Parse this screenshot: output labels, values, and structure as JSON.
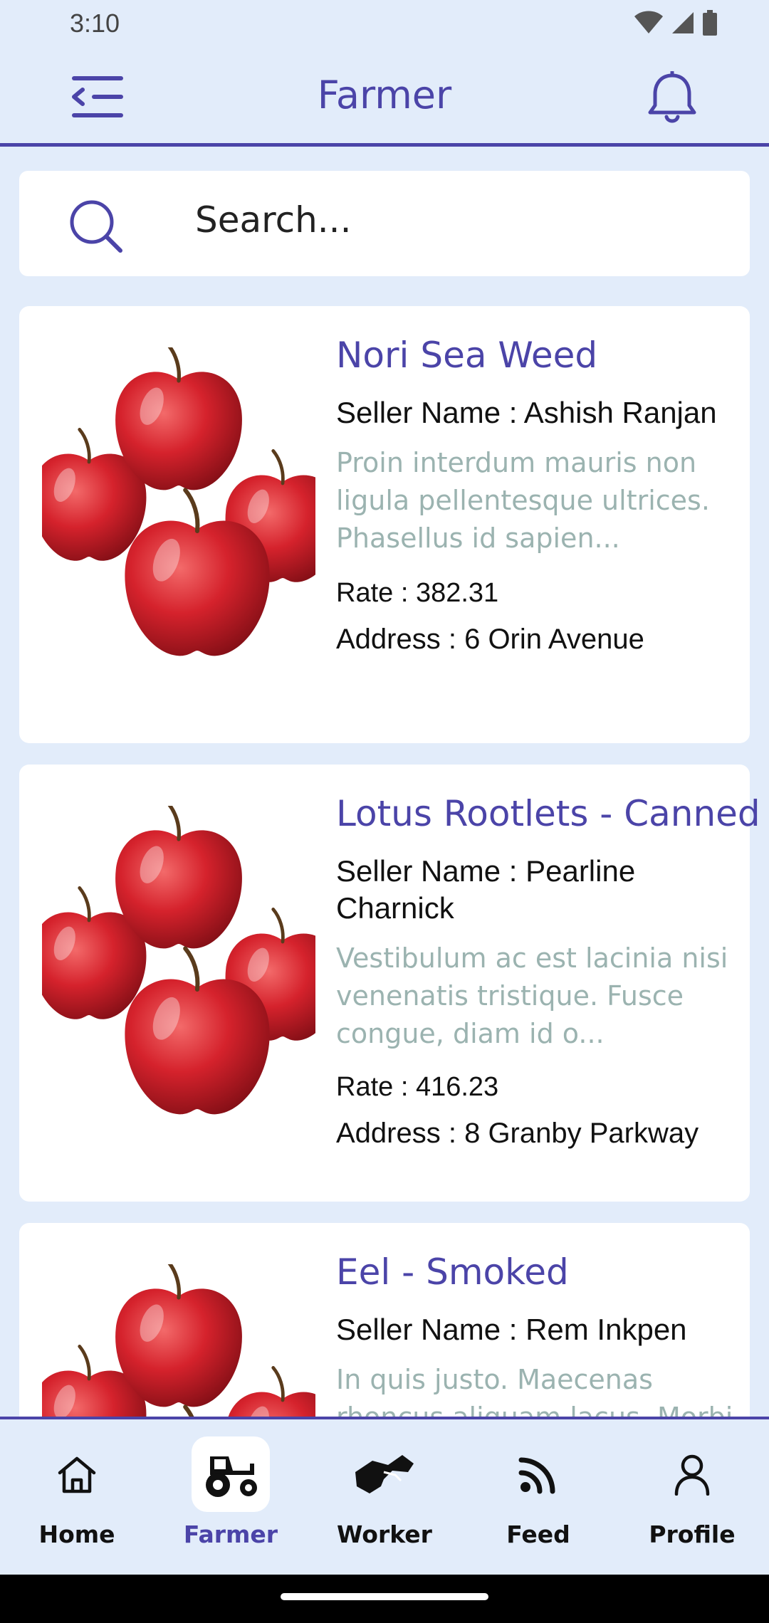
{
  "status_bar": {
    "time": "3:10"
  },
  "app_bar": {
    "title": "Farmer"
  },
  "search": {
    "placeholder": "Search..."
  },
  "products": [
    {
      "title": "Nori Sea Weed",
      "seller": "Seller Name : Ashish Ranjan",
      "description": "Proin interdum mauris non ligula pellentesque ultrices. Phasellus id sapien...",
      "rate": "Rate : 382.31",
      "address": "Address : 6 Orin Avenue",
      "image_icon": "apples-image"
    },
    {
      "title": "Lotus Rootlets - Canned",
      "seller": "Seller Name : Pearline Charnick",
      "description": "Vestibulum ac est lacinia nisi venenatis tristique. Fusce congue, diam id o...",
      "rate": "Rate : 416.23",
      "address": "Address : 8 Granby Parkway",
      "image_icon": "apples-image"
    },
    {
      "title": "Eel - Smoked",
      "seller": "Seller Name : Rem Inkpen",
      "description": "In quis justo. Maecenas rhoncus aliquam lacus. Morbi",
      "image_icon": "apples-image"
    }
  ],
  "bottom_nav": {
    "items": [
      {
        "label": "Home",
        "icon": "home-icon"
      },
      {
        "label": "Farmer",
        "icon": "tractor-icon",
        "active": true
      },
      {
        "label": "Worker",
        "icon": "handshake-icon"
      },
      {
        "label": "Feed",
        "icon": "rss-icon"
      },
      {
        "label": "Profile",
        "icon": "person-icon"
      }
    ]
  },
  "colors": {
    "accent": "#4b44a8",
    "background": "#e2ecfa",
    "card": "#ffffff",
    "description_text": "#9bb3b0"
  }
}
